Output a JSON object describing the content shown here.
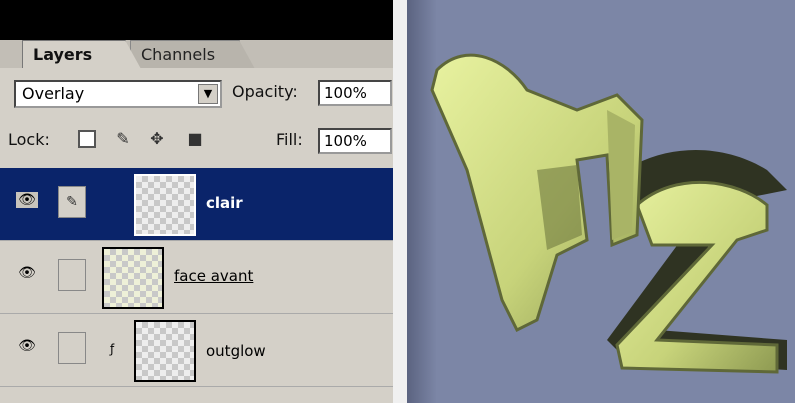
{
  "layers_panel": {
    "tabs": [
      {
        "label": "Layers"
      },
      {
        "label": "Channels"
      }
    ],
    "blend_mode": "Overlay",
    "opacity_label": "Opacity:",
    "opacity_value": "100%",
    "lock_label": "Lock:",
    "fill_label": "Fill:",
    "fill_value": "100%",
    "layers": [
      {
        "name": "clair",
        "selected": true
      },
      {
        "name": "face avant",
        "selected": false
      },
      {
        "name": "outglow",
        "selected": false
      }
    ]
  },
  "colors": {
    "panel_bg": "#d4d0c8",
    "selected_row": "#0a246a",
    "canvas_bg": "#7c86a6",
    "letter_fill": "#c7d37a",
    "letter_shadow": "#2f3322"
  },
  "icons": {
    "eye": "eye-icon",
    "brush": "brush-icon",
    "move": "move-icon",
    "lock": "lock-icon",
    "fx": "effects-icon"
  }
}
